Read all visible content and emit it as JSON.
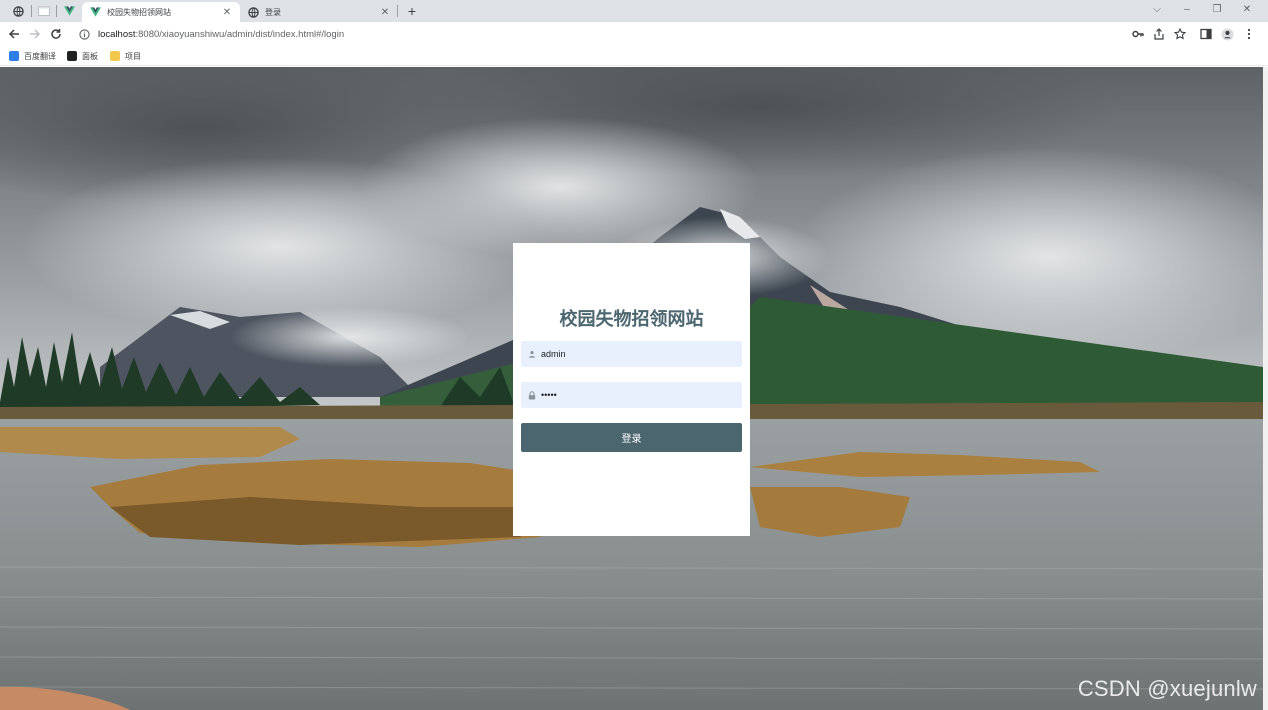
{
  "tabs": [
    {
      "title": "校园失物招领网站",
      "favicon": "vue-icon",
      "active": true
    },
    {
      "title": "登录",
      "favicon": "globe-icon",
      "active": false
    }
  ],
  "toolbar": {
    "url_host": "localhost",
    "url_path": ":8080/xiaoyuanshiwu/admin/dist/index.html#/login"
  },
  "bookmarks": [
    {
      "label": "百度翻译",
      "icon": "translate-icon",
      "color": "#2f7fe8"
    },
    {
      "label": "面板",
      "icon": "panel-icon",
      "color": "#202124"
    },
    {
      "label": "项目",
      "icon": "folder-icon",
      "color": "#f2c94c"
    }
  ],
  "login": {
    "title": "校园失物招领网站",
    "username_value": "admin",
    "password_value": "admin",
    "button_label": "登录"
  },
  "watermark": "CSDN @xuejunlw",
  "colors": {
    "accent": "#4c6670",
    "input_bg": "#e8f0fe",
    "tabbar_bg": "#dee1e6"
  }
}
